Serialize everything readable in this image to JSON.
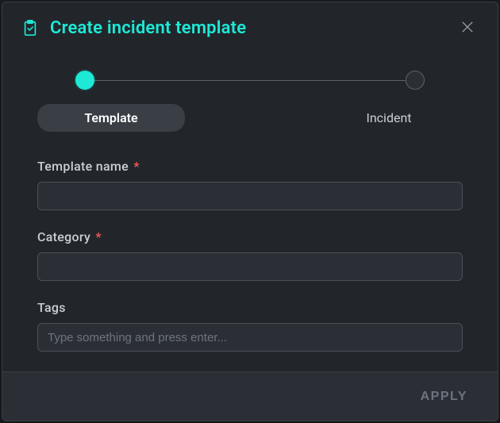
{
  "dialog": {
    "title": "Create incident template"
  },
  "stepper": {
    "steps": [
      {
        "label": "Template",
        "active": true
      },
      {
        "label": "Incident",
        "active": false
      }
    ]
  },
  "form": {
    "template_name": {
      "label": "Template name",
      "value": "",
      "required": true
    },
    "category": {
      "label": "Category",
      "value": "",
      "required": true
    },
    "tags": {
      "label": "Tags",
      "placeholder": "Type something and press enter...",
      "value": ""
    }
  },
  "footer": {
    "apply_label": "APPLY"
  },
  "required_marker": "*"
}
